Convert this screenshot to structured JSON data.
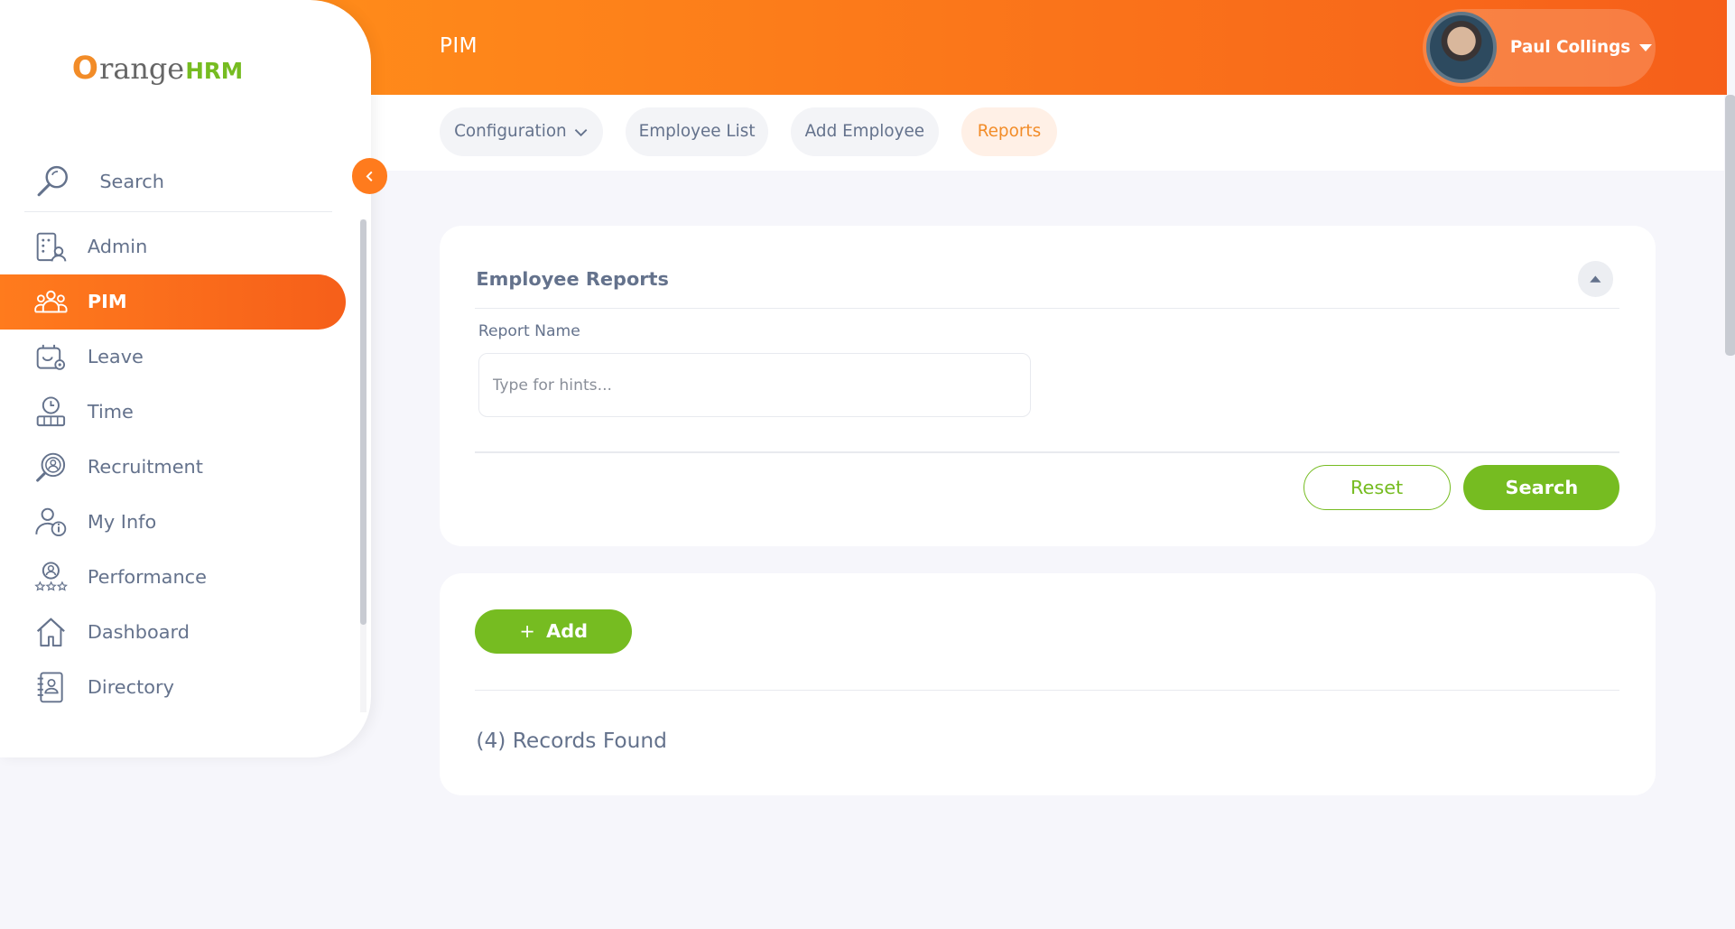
{
  "brand": {
    "o": "O",
    "rest": "range",
    "hrm": "HRM"
  },
  "sidebar": {
    "search_label": "Search",
    "items": [
      {
        "label": "Admin",
        "icon": "admin-icon"
      },
      {
        "label": "PIM",
        "icon": "pim-icon",
        "active": true
      },
      {
        "label": "Leave",
        "icon": "leave-icon"
      },
      {
        "label": "Time",
        "icon": "time-icon"
      },
      {
        "label": "Recruitment",
        "icon": "recruitment-icon"
      },
      {
        "label": "My Info",
        "icon": "my-info-icon"
      },
      {
        "label": "Performance",
        "icon": "performance-icon"
      },
      {
        "label": "Dashboard",
        "icon": "dashboard-icon"
      },
      {
        "label": "Directory",
        "icon": "directory-icon"
      }
    ]
  },
  "header": {
    "title": "PIM",
    "user_name": "Paul Collings"
  },
  "tabs": [
    {
      "label": "Configuration",
      "has_dropdown": true
    },
    {
      "label": "Employee List"
    },
    {
      "label": "Add Employee"
    },
    {
      "label": "Reports",
      "active": true
    }
  ],
  "filter": {
    "title": "Employee Reports",
    "field_label": "Report Name",
    "field_placeholder": "Type for hints...",
    "reset_label": "Reset",
    "search_label": "Search"
  },
  "results": {
    "add_label": "Add",
    "add_prefix": "+",
    "records_text": "(4) Records Found"
  },
  "colors": {
    "accent": "#ff7b1d",
    "green": "#76bc21",
    "text": "#64728c"
  }
}
